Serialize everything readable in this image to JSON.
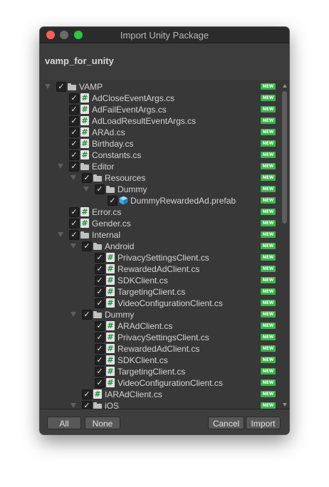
{
  "window": {
    "title": "Import Unity Package",
    "package_name": "vamp_for_unity"
  },
  "new_badge": "NEW",
  "tree": [
    {
      "label": "VAMP",
      "icon": "folder",
      "depth": 0,
      "expanded": true,
      "checked": true
    },
    {
      "label": "AdCloseEventArgs.cs",
      "icon": "script",
      "depth": 1,
      "checked": true
    },
    {
      "label": "AdFailEventArgs.cs",
      "icon": "script",
      "depth": 1,
      "checked": true
    },
    {
      "label": "AdLoadResultEventArgs.cs",
      "icon": "script",
      "depth": 1,
      "checked": true
    },
    {
      "label": "ARAd.cs",
      "icon": "script",
      "depth": 1,
      "checked": true
    },
    {
      "label": "Birthday.cs",
      "icon": "script",
      "depth": 1,
      "checked": true
    },
    {
      "label": "Constants.cs",
      "icon": "script",
      "depth": 1,
      "checked": true
    },
    {
      "label": "Editor",
      "icon": "folder",
      "depth": 1,
      "expanded": true,
      "checked": true
    },
    {
      "label": "Resources",
      "icon": "folder",
      "depth": 2,
      "expanded": true,
      "checked": true
    },
    {
      "label": "Dummy",
      "icon": "folder",
      "depth": 3,
      "expanded": true,
      "checked": true
    },
    {
      "label": "DummyRewardedAd.prefab",
      "icon": "prefab",
      "depth": 4,
      "checked": true
    },
    {
      "label": "Error.cs",
      "icon": "script",
      "depth": 1,
      "checked": true
    },
    {
      "label": "Gender.cs",
      "icon": "script",
      "depth": 1,
      "checked": true
    },
    {
      "label": "Internal",
      "icon": "folder",
      "depth": 1,
      "expanded": true,
      "checked": true
    },
    {
      "label": "Android",
      "icon": "folder",
      "depth": 2,
      "expanded": true,
      "checked": true
    },
    {
      "label": "PrivacySettingsClient.cs",
      "icon": "script",
      "depth": 3,
      "checked": true
    },
    {
      "label": "RewardedAdClient.cs",
      "icon": "script",
      "depth": 3,
      "checked": true
    },
    {
      "label": "SDKClient.cs",
      "icon": "script",
      "depth": 3,
      "checked": true
    },
    {
      "label": "TargetingClient.cs",
      "icon": "script",
      "depth": 3,
      "checked": true
    },
    {
      "label": "VideoConfigurationClient.cs",
      "icon": "script",
      "depth": 3,
      "checked": true
    },
    {
      "label": "Dummy",
      "icon": "folder",
      "depth": 2,
      "expanded": true,
      "checked": true
    },
    {
      "label": "ARAdClient.cs",
      "icon": "script",
      "depth": 3,
      "checked": true
    },
    {
      "label": "PrivacySettingsClient.cs",
      "icon": "script",
      "depth": 3,
      "checked": true
    },
    {
      "label": "RewardedAdClient.cs",
      "icon": "script",
      "depth": 3,
      "checked": true
    },
    {
      "label": "SDKClient.cs",
      "icon": "script",
      "depth": 3,
      "checked": true
    },
    {
      "label": "TargetingClient.cs",
      "icon": "script",
      "depth": 3,
      "checked": true
    },
    {
      "label": "VideoConfigurationClient.cs",
      "icon": "script",
      "depth": 3,
      "checked": true
    },
    {
      "label": "IARAdClient.cs",
      "icon": "script",
      "depth": 2,
      "checked": true
    },
    {
      "label": "iOS",
      "icon": "folder",
      "depth": 2,
      "expanded": true,
      "checked": true
    }
  ],
  "footer": {
    "all_label": "All",
    "none_label": "None",
    "cancel_label": "Cancel",
    "import_label": "Import"
  },
  "colors": {
    "window_bg": "#383838",
    "new_badge": "#3ab54a",
    "script_hash": "#1f8f3a",
    "close_light": "#fe5f57",
    "max_light": "#28c840"
  },
  "scrollbar": {
    "position_fraction": 0.0
  }
}
